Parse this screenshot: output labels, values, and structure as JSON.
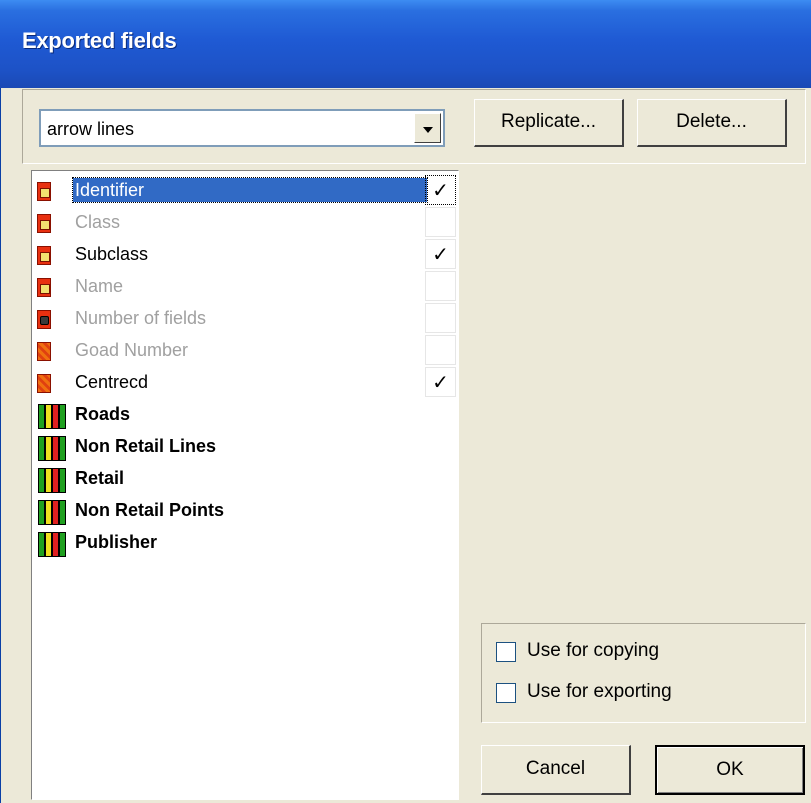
{
  "window": {
    "title": "Exported fields"
  },
  "combo": {
    "value": "arrow lines"
  },
  "buttons": {
    "replicate": "Replicate...",
    "delete": "Delete...",
    "cancel": "Cancel",
    "ok": "OK"
  },
  "fields": [
    {
      "label": "Identifier",
      "checked": "✓",
      "icon": "field-icon"
    },
    {
      "label": "Class",
      "checked": "",
      "icon": "field-icon"
    },
    {
      "label": "Subclass",
      "checked": "✓",
      "icon": "field-icon"
    },
    {
      "label": "Name",
      "checked": "",
      "icon": "field-icon"
    },
    {
      "label": "Number of fields",
      "checked": "",
      "icon": "number-field-icon"
    },
    {
      "label": "Goad Number",
      "checked": "",
      "icon": "plain-field-icon"
    },
    {
      "label": "Centrecd",
      "checked": "✓",
      "icon": "plain-field-icon"
    }
  ],
  "groups": [
    {
      "label": "Roads",
      "icon": "layer-group-icon"
    },
    {
      "label": "Non Retail Lines",
      "icon": "layer-group-icon"
    },
    {
      "label": "Retail",
      "icon": "layer-group-icon"
    },
    {
      "label": "Non Retail Points",
      "icon": "layer-group-icon"
    },
    {
      "label": "Publisher",
      "icon": "layer-group-icon"
    }
  ],
  "options": {
    "copying": "Use for copying",
    "exporting": "Use for exporting"
  },
  "colors": {
    "titlebar": "#1f5ad4",
    "selection": "#316ac5",
    "face": "#ece9d8"
  }
}
